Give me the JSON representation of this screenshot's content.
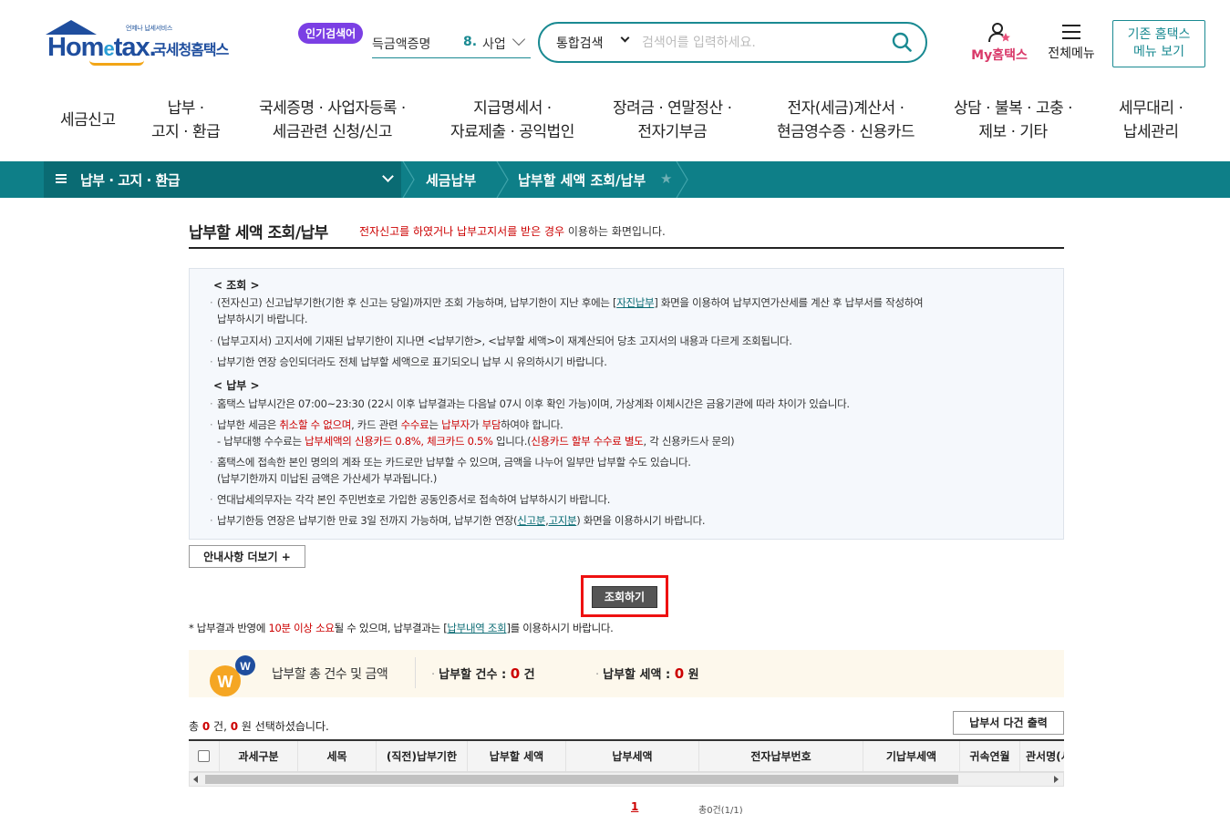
{
  "header": {
    "logo_sub": "언제나 납세서비스",
    "logo_text_a": "Hom",
    "logo_text_e": "e",
    "logo_text_b": "tax.",
    "logo_kr": "국세청홈택스",
    "popular_badge": "인기검색어",
    "popular_prev": "득금액증명",
    "popular_rank": "8.",
    "popular_word": "사업",
    "search_scope": "통합검색",
    "search_placeholder": "검색어를 입력하세요.",
    "myhome_label": "My홈택스",
    "allmenu_label": "전체메뉴",
    "old_btn_line1": "기존 홈택스",
    "old_btn_line2": "메뉴 보기"
  },
  "gnb": [
    {
      "l1": "세금신고",
      "l2": ""
    },
    {
      "l1": "납부 ·",
      "l2": "고지 · 환급"
    },
    {
      "l1": "국세증명 · 사업자등록 ·",
      "l2": "세금관련 신청/신고"
    },
    {
      "l1": "지급명세서 ·",
      "l2": "자료제출 · 공익법인"
    },
    {
      "l1": "장려금 · 연말정산 ·",
      "l2": "전자기부금"
    },
    {
      "l1": "전자(세금)계산서 ·",
      "l2": "현금영수증 · 신용카드"
    },
    {
      "l1": "상담 · 불복 · 고충 ·",
      "l2": "제보 · 기타"
    },
    {
      "l1": "세무대리 ·",
      "l2": "납세관리"
    }
  ],
  "location": {
    "level1": "납부 · 고지 · 환급",
    "level2": "세금납부",
    "level3": "납부할 세액 조회/납부",
    "star": "★"
  },
  "page": {
    "title": "납부할 세액 조회/납부",
    "desc_red": "전자신고를 하였거나 납부고지서를 받은 경우",
    "desc_rest": " 이용하는 화면입니다."
  },
  "guide": {
    "head_query": "< 조회 >",
    "q1a": "(전자신고) 신고납부기한(기한 후 신고는 당일)까지만 조회 가능하며, 납부기한이 지난 후에는 [",
    "q1_link": "자진납부",
    "q1b": "] 화면을 이용하여 납부지연가산세를 계산 후 납부서를 작성하여",
    "q1c": "납부하시기 바랍니다.",
    "q2": "(납부고지서) 고지서에 기재된 납부기한이 지나면 <납부기한>, <납부할 세액>이 재계산되어 당초 고지서의 내용과 다르게 조회됩니다.",
    "q3": "납부기한 연장 승인되더라도 전체 납부할 세액으로 표기되오니 납부 시 유의하시기 바랍니다.",
    "head_pay": "< 납부 >",
    "p1": "홈택스 납부시간은 07:00~23:30 (22시 이후 납부결과는 다음날 07시 이후 확인 가능)이며, 가상계좌 이체시간은 금융기관에 따라 차이가 있습니다.",
    "p2a": "납부한 세금은 ",
    "p2_red1": "취소할 수 없으며",
    "p2b": ", 카드 관련 ",
    "p2_red2": "수수료",
    "p2c": "는 ",
    "p2_red3": "납부자",
    "p2d": "가 ",
    "p2_red4": "부담",
    "p2e": "하여야 합니다.",
    "p2f": "- 납부대행 수수료는 ",
    "p2_red5": "납부세액의 신용카드 0.8%, 체크카드 0.5%",
    "p2g": " 입니다.(",
    "p2_red6": "신용카드 할부 수수료 별도",
    "p2h": ", 각 신용카드사 문의)",
    "p3a": "홈택스에 접속한 본인 명의의 계좌 또는 카드로만 납부할 수 있으며, 금액을 나누어 일부만 납부할 수도 있습니다.",
    "p3b": "(납부기한까지 미납된 금액은 가산세가 부과됩니다.)",
    "p4": "연대납세의무자는 각각 본인 주민번호로 가입한 공동인증서로 접속하여 납부하시기 바랍니다.",
    "p5a": "납부기한등 연장은 납부기한 만료 3일 전까지 가능하며, 납부기한 연장(",
    "p5_link1": "신고분",
    "p5_comma": ",",
    "p5_link2": "고지분",
    "p5b": ") 화면을 이용하시기 바랍니다."
  },
  "buttons": {
    "more": "안내사항 더보기 +",
    "query": "조회하기",
    "print": "납부서 다건 출력"
  },
  "note": {
    "a": "* 납부결과 반영에 ",
    "red": "10분 이상 소요",
    "b": "될 수 있으며, 납부결과는 [",
    "link": "납부내역 조회",
    "c": "]를 이용하시기 바랍니다."
  },
  "summary": {
    "label": "납부할 총 건수 및 금액",
    "count_label": "납부할 건수 : ",
    "count_value": "0",
    "count_unit": " 건",
    "amount_label": "납부할 세액 : ",
    "amount_value": "0",
    "amount_unit": " 원"
  },
  "selection": {
    "a": "총 ",
    "count": "0",
    "b": " 건, ",
    "amount": "0",
    "c": " 원 선택하셨습니다."
  },
  "grid_headers": [
    "과세구분",
    "세목",
    "(직전)납부기한",
    "납부할 세액",
    "납부세액",
    "전자납부번호",
    "기납부세액",
    "귀속연월",
    "관서명(서)"
  ],
  "pager": {
    "current": "1",
    "total": "총0건(1/1)"
  }
}
